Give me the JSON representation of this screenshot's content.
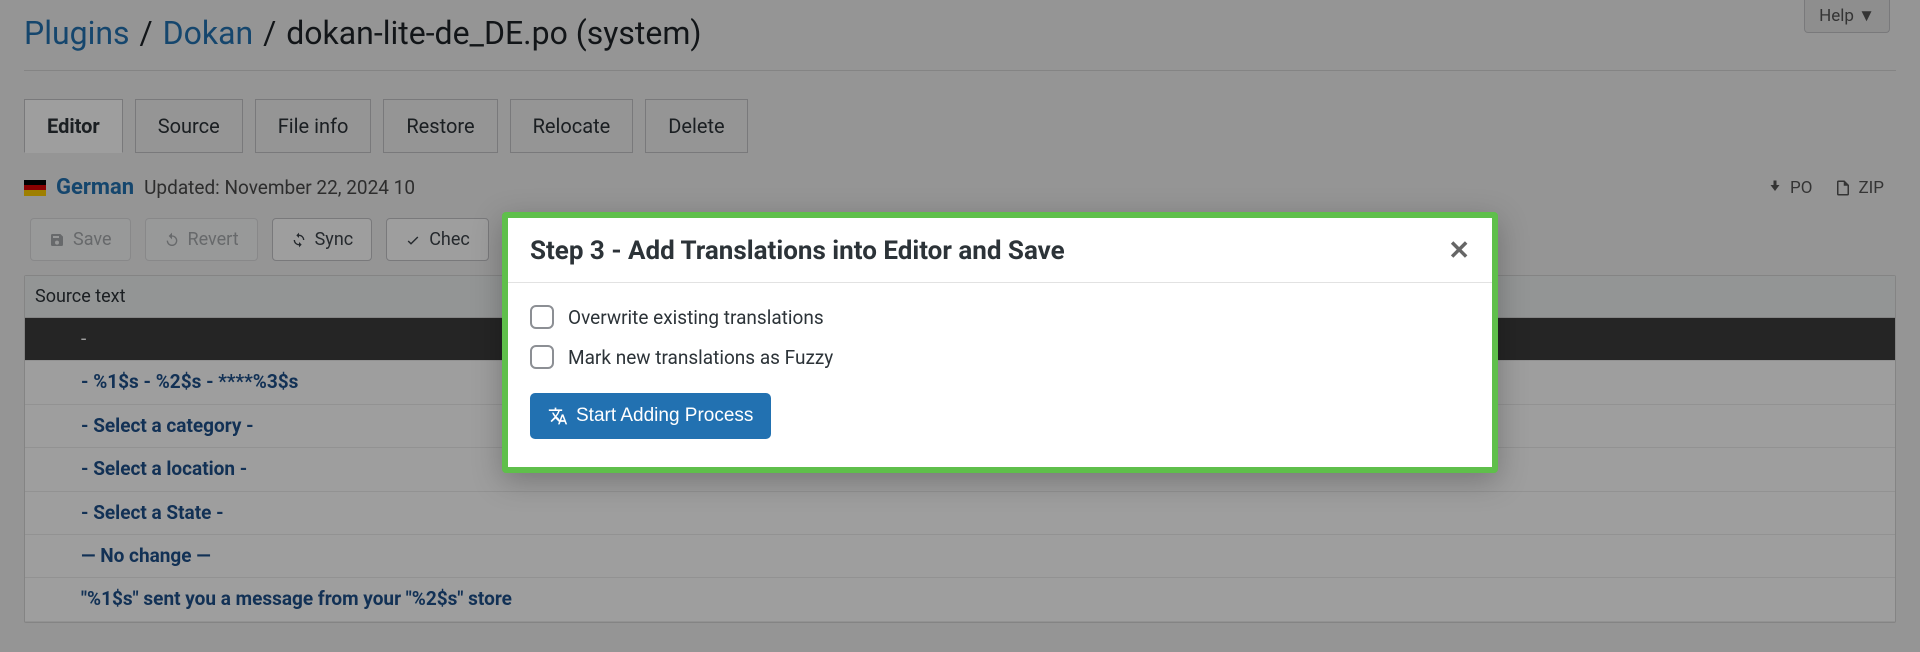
{
  "help_label": "Help ▼",
  "breadcrumb": {
    "plugins": "Plugins",
    "dokan": "Dokan",
    "file": "dokan-lite-de_DE.po (system)"
  },
  "tabs": {
    "editor": "Editor",
    "source": "Source",
    "fileinfo": "File info",
    "restore": "Restore",
    "relocate": "Relocate",
    "delete": "Delete"
  },
  "lang": {
    "name": "German",
    "updated": "Updated: November 22, 2024 10"
  },
  "downloads": {
    "po": "PO",
    "zip": "ZIP"
  },
  "toolbar": {
    "save": "Save",
    "revert": "Revert",
    "sync": "Sync",
    "check": "Chec"
  },
  "table": {
    "header": "Source text",
    "rows": [
      "-",
      "- %1$s - %2$s - ****%3$s",
      "- Select a category -",
      "- Select a location -",
      "- Select a State -",
      "— No change —",
      "\"%1$s\" sent you a message from your \"%2$s\" store"
    ]
  },
  "modal": {
    "title": "Step 3 - Add Translations into Editor and Save",
    "overwrite": "Overwrite existing translations",
    "fuzzy": "Mark new translations as Fuzzy",
    "start": "Start Adding Process"
  }
}
